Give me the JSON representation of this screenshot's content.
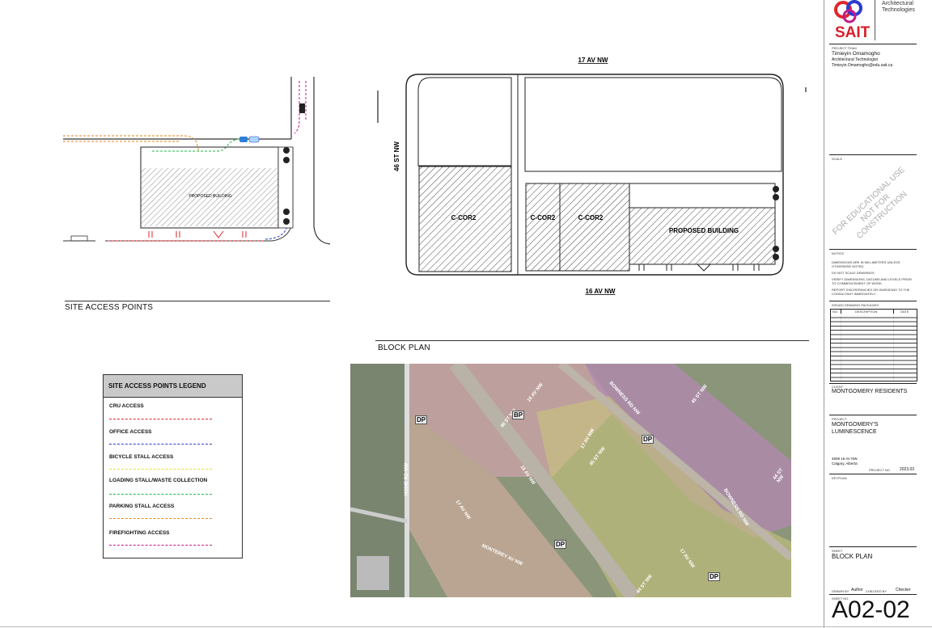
{
  "site_access": {
    "title": "SITE ACCESS POINTS",
    "building_label": "PROPOSED BUILDING"
  },
  "block_plan": {
    "title": "BLOCK PLAN",
    "streets": {
      "north": "17 AV NW",
      "south": "16 AV NW",
      "west": "46 ST NW"
    },
    "parcels": [
      "C-COR2",
      "C-COR2",
      "C-COR2",
      "PROPOSED BUILDING"
    ]
  },
  "legend": {
    "title": "SITE ACCESS POINTS LEGEND",
    "items": [
      {
        "label": "CRU ACCESS",
        "color": "#e0262b"
      },
      {
        "label": "OFFICE ACCESS",
        "color": "#2a3bd0"
      },
      {
        "label": "BICYCLE STALL ACCESS",
        "color": "#e5e235"
      },
      {
        "label": "LOADING STALL/WASTE COLLECTION",
        "color": "#22b74a"
      },
      {
        "label": "PARKING STALL ACCESS",
        "color": "#e08a1e"
      },
      {
        "label": "FIREFIGHTING ACCESS",
        "color": "#c21a8c"
      }
    ]
  },
  "map": {
    "street_labels": [
      "16 AV NW",
      "46 ST NW",
      "17 AV NW",
      "45 ST NW",
      "BOWNESS RD NW",
      "16 AV NW",
      "17 AV NW",
      "MONTEREY AV NW",
      "HOME RD NW",
      "45 ST NW",
      "44 ST NW",
      "17 AV NW",
      "BOWNESS RD NW",
      "44 ST NW"
    ],
    "markers": [
      "BP",
      "DP"
    ]
  },
  "title_block": {
    "logo_text": "SAIT",
    "logo_subtitle_1": "Architectural",
    "logo_subtitle_2": "Technologies",
    "project_team_label": "PROJECT TEAM",
    "team_name": "Timieyin Omamogho",
    "team_role": "Architectural Technologist",
    "team_email": "Timieyin.Omamogho@edu.sait.ca",
    "scale_label": "SCALE",
    "stamp_line1": "FOR EDUCATIONAL USE",
    "stamp_line2": "NOT FOR CONSTRUCTION",
    "notice_label": "NOTICE",
    "notices": [
      "DIMENSIONS ARE IN MILLIMETERS UNLESS OTHERWISE NOTED.",
      "DO NOT SCALE DRAWINGS.",
      "VERIFY DIMENSIONS, DATUMS AND LEVELS PRIOR TO COMMENCEMENT OF WORK.",
      "REPORT DISCREPANCIES OR OMISSIONS TO THE CONSULTANT IMMEDIATELY."
    ],
    "issued_label": "ISSUED DRAWING PACKAGES",
    "issued_headers": [
      "NO.",
      "DESCRIPTION",
      "DATE"
    ],
    "issued_rows": [
      [
        "",
        "ISSUED FOR FINAL",
        "2023-11-01"
      ]
    ],
    "client_label": "CLIENT",
    "client": "MONTGOMERY RESIDENTS",
    "project_label": "PROJECT",
    "project_name_1": "MONTGOMERY'S",
    "project_name_2": "LUMINESCENCE",
    "address_1": "4608 16 AV NW",
    "address_2": "Calgary, Alberta",
    "project_no_label": "PROJECT NO.",
    "project_no": "2023.03",
    "keyplan_label": "KEYPLAN",
    "sheet_label": "SHEET",
    "sheet_name": "BLOCK PLAN",
    "drawn_by_label": "DRAWN BY",
    "drawn_by": "Author",
    "checked_by_label": "CHECKED BY",
    "checked_by": "Checker",
    "sheet_no_label": "SHEET NO.",
    "sheet_no": "A02-02"
  }
}
